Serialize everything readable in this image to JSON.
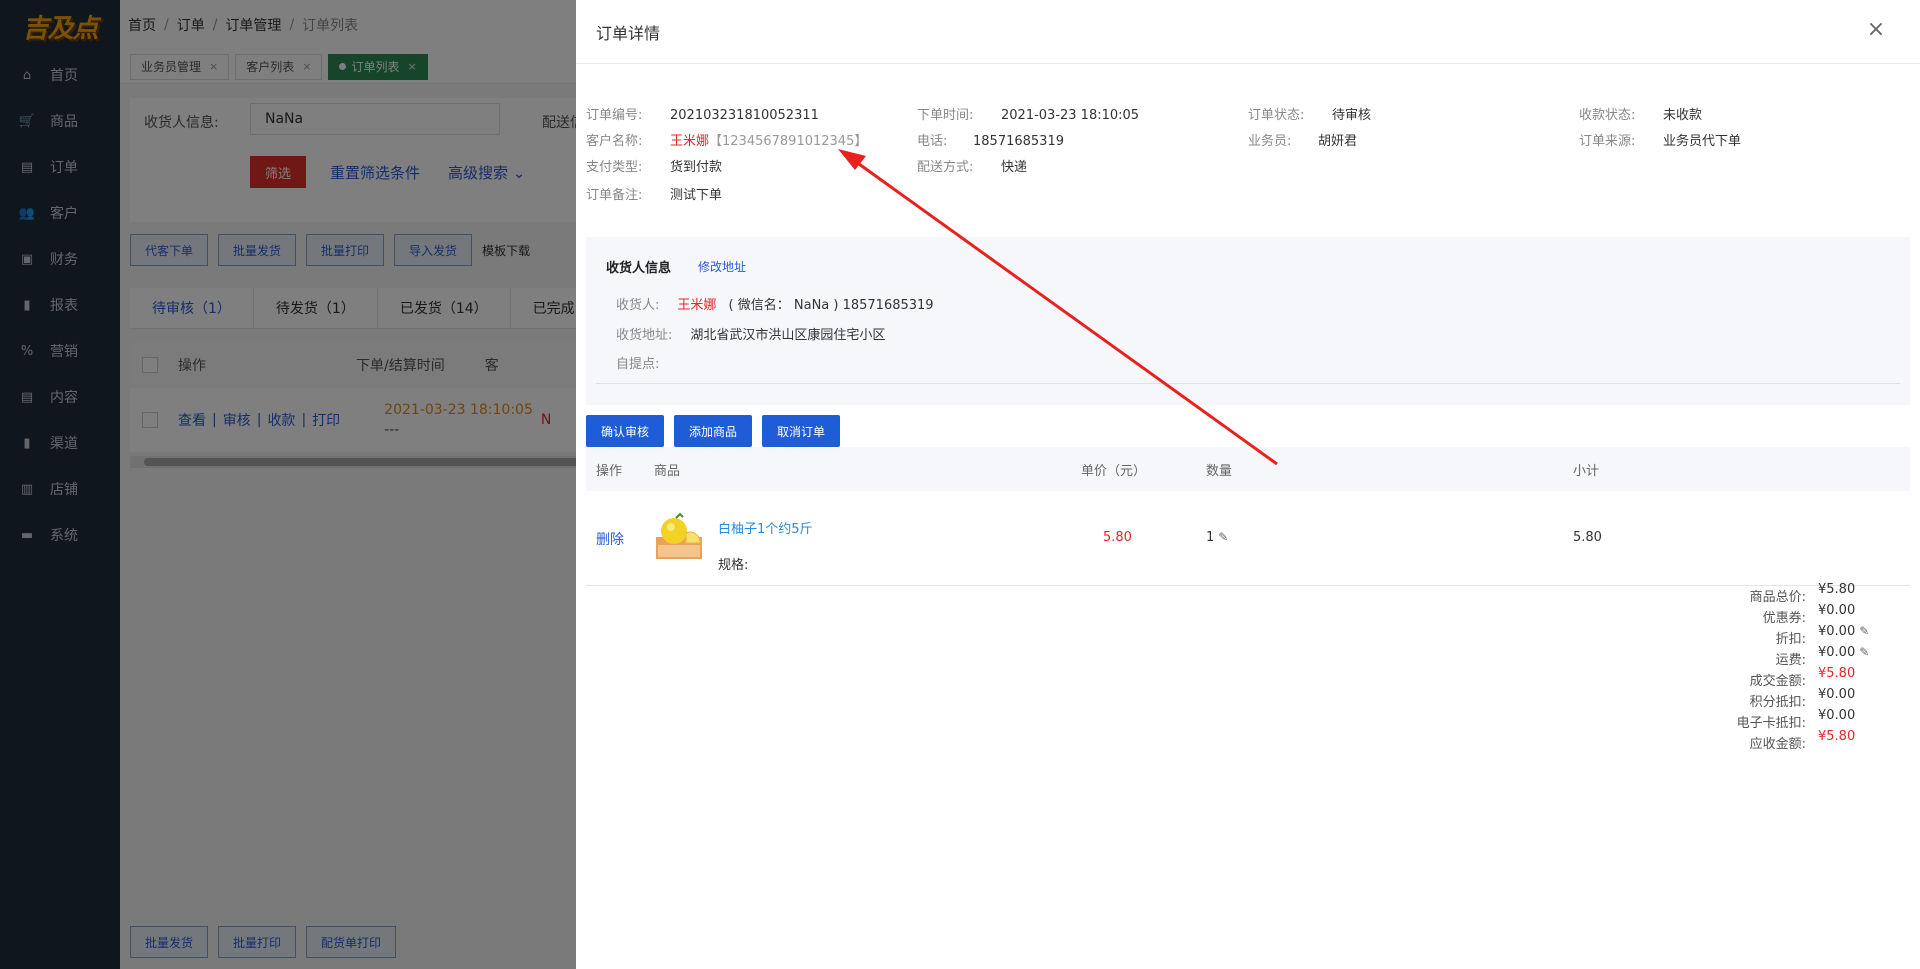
{
  "app": {
    "logo_text": "吉及点",
    "colors": {
      "sidebar_bg": "#1f2d3d",
      "accent_blue": "#1e5cd8",
      "danger_red": "#e4262a",
      "active_tag": "#2e8b57"
    }
  },
  "sidebar": {
    "items": [
      {
        "label": "首页",
        "icon": "home-icon"
      },
      {
        "label": "商品",
        "icon": "cart-icon"
      },
      {
        "label": "订单",
        "icon": "order-icon"
      },
      {
        "label": "客户",
        "icon": "users-icon"
      },
      {
        "label": "财务",
        "icon": "wallet-icon"
      },
      {
        "label": "报表",
        "icon": "bar-chart-icon"
      },
      {
        "label": "营销",
        "icon": "percent-icon"
      },
      {
        "label": "内容",
        "icon": "document-icon"
      },
      {
        "label": "渠道",
        "icon": "bar-chart-icon"
      },
      {
        "label": "店铺",
        "icon": "store-icon"
      },
      {
        "label": "系统",
        "icon": "monitor-icon"
      }
    ]
  },
  "breadcrumb": {
    "items": [
      "首页",
      "订单",
      "订单管理",
      "订单列表"
    ]
  },
  "page_tabs": {
    "items": [
      {
        "label": "业务员管理"
      },
      {
        "label": "客户列表"
      },
      {
        "label": "订单列表"
      }
    ],
    "close_glyph": "×"
  },
  "filter": {
    "receiver_label": "收货人信息:",
    "receiver_value": "NaNa",
    "delivery_label": "配送信",
    "filter_button": "筛选",
    "reset_link": "重置筛选条件",
    "advanced_link": "高级搜索"
  },
  "toolbar": {
    "buttons": [
      "代客下单",
      "批量发货",
      "批量打印",
      "导入发货"
    ],
    "template_link": "模板下载"
  },
  "status_tabs": {
    "items": [
      "待审核（1）",
      "待发货（1）",
      "已发货（14）",
      "已完成（"
    ]
  },
  "table": {
    "headers": {
      "op": "操作",
      "time": "下单/结算时间",
      "more": "客"
    },
    "row": {
      "actions": [
        "查看",
        "审核",
        "收款",
        "打印"
      ],
      "action_sep": "|",
      "time": "2021-03-23 18:10:05",
      "time2": "---",
      "more": "N"
    }
  },
  "bottom_bar": {
    "buttons": [
      "批量发货",
      "批量打印",
      "配货单打印"
    ]
  },
  "drawer": {
    "title": "订单详情",
    "close_glyph": "×",
    "info": {
      "order_no_label": "订单编号:",
      "order_no": "202103231810052311",
      "order_time_label": "下单时间:",
      "order_time": "2021-03-23 18:10:05",
      "order_status_label": "订单状态:",
      "order_status": "待审核",
      "pay_status_label": "收款状态:",
      "pay_status": "未收款",
      "customer_label": "客户名称:",
      "customer_name": "王米娜",
      "customer_code": "【1234567891012345】",
      "phone_label": "电话:",
      "phone": "18571685319",
      "salesman_label": "业务员:",
      "salesman": "胡妍君",
      "source_label": "订单来源:",
      "source": "业务员代下单",
      "pay_type_label": "支付类型:",
      "pay_type": "货到付款",
      "delivery_label": "配送方式:",
      "delivery": "快递",
      "remark_label": "订单备注:",
      "remark": "测试下单"
    },
    "consignee": {
      "title": "收货人信息",
      "edit_link": "修改地址",
      "receiver_label": "收货人:",
      "receiver_name": "王米娜",
      "receiver_wechat": "( 微信名： NaNa     ) 18571685319",
      "address_label": "收货地址:",
      "address": "湖北省武汉市洪山区康园住宅小区",
      "pickup_label": "自提点:"
    },
    "actions": [
      "确认审核",
      "添加商品",
      "取消订单"
    ],
    "items_head": {
      "op": "操作",
      "product": "商品",
      "price": "单价（元）",
      "qty": "数量",
      "subtotal": "小计"
    },
    "items": [
      {
        "delete": "删除",
        "name": "白柚子1个约5斤",
        "spec": "规格:",
        "price": "5.80",
        "qty": "1",
        "subtotal": "5.80"
      }
    ],
    "totals": [
      {
        "label": "商品总价:",
        "value": "¥5.80",
        "editable": false,
        "red": false
      },
      {
        "label": "优惠券:",
        "value": "¥0.00",
        "editable": false,
        "red": false
      },
      {
        "label": "折扣:",
        "value": "¥0.00",
        "editable": true,
        "red": false
      },
      {
        "label": "运费:",
        "value": "¥0.00",
        "editable": true,
        "red": false
      },
      {
        "label": "成交金额:",
        "value": "¥5.80",
        "editable": false,
        "red": true
      },
      {
        "label": "积分抵扣:",
        "value": "¥0.00",
        "editable": false,
        "red": false
      },
      {
        "label": "电子卡抵扣:",
        "value": "¥0.00",
        "editable": false,
        "red": false
      },
      {
        "label": "应收金额:",
        "value": "¥5.80",
        "editable": false,
        "red": true
      }
    ]
  }
}
